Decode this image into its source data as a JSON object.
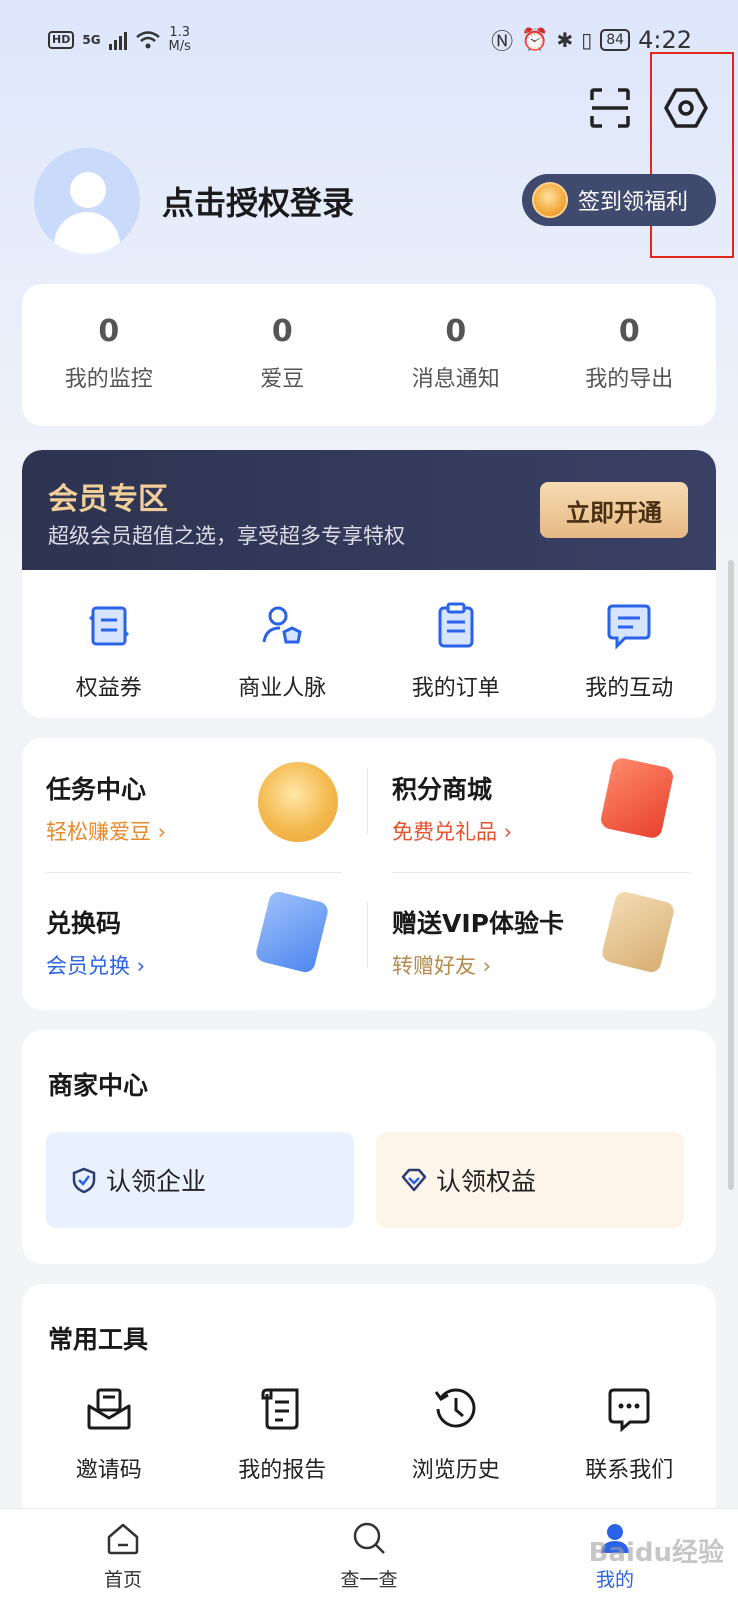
{
  "status_bar": {
    "hd": "HD",
    "network": "5G",
    "speed_value": "1.3",
    "speed_unit": "M/s",
    "battery": "84",
    "time": "4:22"
  },
  "header": {
    "scan_icon": "scan-icon",
    "settings_icon": "settings-hexagon-icon",
    "highlight_color": "#e3261b"
  },
  "profile": {
    "login_text": "点击授权登录",
    "signin_label": "签到领福利"
  },
  "stats": [
    {
      "value": "0",
      "label": "我的监控"
    },
    {
      "value": "0",
      "label": "爱豆"
    },
    {
      "value": "0",
      "label": "消息通知"
    },
    {
      "value": "0",
      "label": "我的导出"
    }
  ],
  "vip": {
    "title": "会员专区",
    "subtitle": "超级会员超值之选，享受超多专享特权",
    "button": "立即开通"
  },
  "quick_links": [
    {
      "label": "权益券",
      "icon": "coupon-icon"
    },
    {
      "label": "商业人脉",
      "icon": "contacts-icon"
    },
    {
      "label": "我的订单",
      "icon": "order-icon"
    },
    {
      "label": "我的互动",
      "icon": "message-icon"
    }
  ],
  "tasks": {
    "task_center": {
      "title": "任务中心",
      "sub": "轻松赚爱豆 ›"
    },
    "points_mall": {
      "title": "积分商城",
      "sub": "免费兑礼品 ›"
    },
    "redeem_code": {
      "title": "兑换码",
      "sub": "会员兑换 ›"
    },
    "gift_vip": {
      "title": "赠送VIP体验卡",
      "sub": "转赠好友 ›"
    }
  },
  "merchant": {
    "title": "商家中心",
    "claim_company": "认领企业",
    "claim_rights": "认领权益"
  },
  "tools": {
    "title": "常用工具",
    "items": [
      {
        "label": "邀请码",
        "icon": "invite-icon"
      },
      {
        "label": "我的报告",
        "icon": "report-icon"
      },
      {
        "label": "浏览历史",
        "icon": "history-icon"
      },
      {
        "label": "联系我们",
        "icon": "contact-us-icon"
      }
    ]
  },
  "tabbar": [
    {
      "label": "首页",
      "icon": "home-icon"
    },
    {
      "label": "查一查",
      "icon": "search-icon"
    },
    {
      "label": "我的",
      "icon": "profile-icon"
    }
  ],
  "watermark": "Baidu经验",
  "colors": {
    "accent_blue": "#2a62e8",
    "vip_gold": "#f2cf99",
    "orange": "#e8892b"
  }
}
